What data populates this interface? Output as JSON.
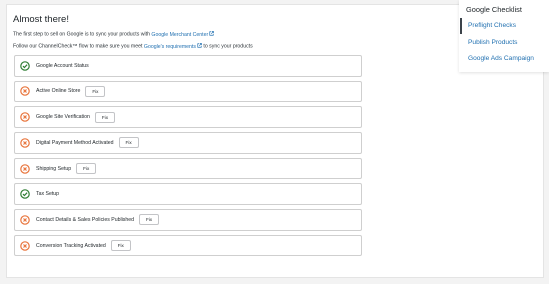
{
  "heading": "Almost there!",
  "intro": {
    "line1_text": "The first step to sell on Google is to sync your products with",
    "line1_link": "Google Merchant Center",
    "line2_prefix": "Follow our ChannelCheck™ flow to make sure you meet",
    "line2_link": "Google's requirements",
    "line2_suffix": "to sync your products"
  },
  "checks": [
    {
      "label": "Google Account Status",
      "status": "success"
    },
    {
      "label": "Active Online Store",
      "status": "error",
      "action": "Fix"
    },
    {
      "label": "Google Site Verification",
      "status": "error",
      "action": "Fix"
    },
    {
      "label": "Digital Payment Method Activated",
      "status": "error",
      "action": "Fix"
    },
    {
      "label": "Shipping Setup",
      "status": "error",
      "action": "Fix"
    },
    {
      "label": "Tax Setup",
      "status": "success"
    },
    {
      "label": "Contact Details & Sales Policies Published",
      "status": "error",
      "action": "Fix"
    },
    {
      "label": "Conversion Tracking Activated",
      "status": "error",
      "action": "Fix"
    }
  ],
  "sidebar": {
    "title": "Google Checklist",
    "items": [
      {
        "label": "Preflight Checks",
        "active": true
      },
      {
        "label": "Publish Products",
        "active": false
      },
      {
        "label": "Google Ads Campaign",
        "active": false
      }
    ]
  },
  "icons": {
    "success": "check-circle-icon",
    "error": "x-circle-icon",
    "external": "external-link-icon"
  },
  "colors": {
    "success": "#2e7d32",
    "error": "#e8743b",
    "link": "#2271b1"
  }
}
